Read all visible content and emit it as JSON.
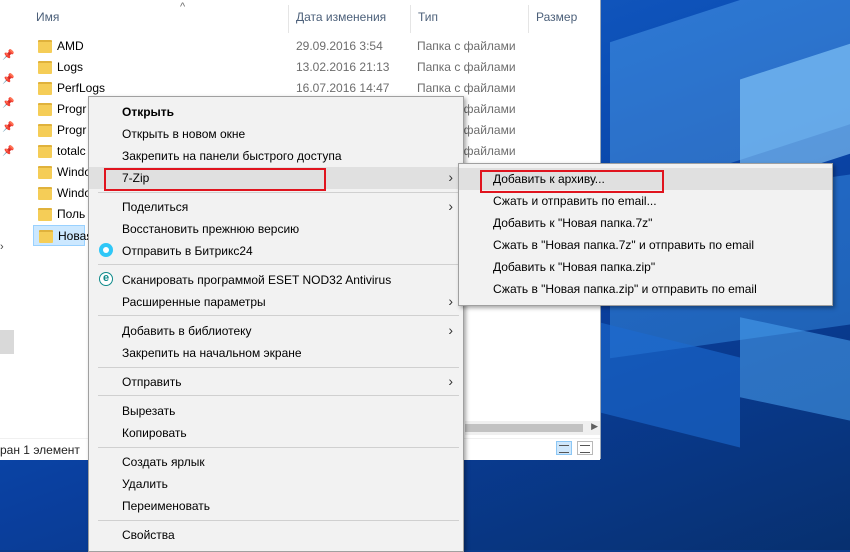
{
  "columns": {
    "name": "Имя",
    "date": "Дата изменения",
    "type": "Тип",
    "size": "Размер"
  },
  "files": [
    {
      "name": "AMD",
      "date": "29.09.2016 3:54",
      "type": "Папка с файлами"
    },
    {
      "name": "Logs",
      "date": "13.02.2016 21:13",
      "type": "Папка с файлами"
    },
    {
      "name": "PerfLogs",
      "date": "16.07.2016 14:47",
      "type": "Папка с файлами"
    },
    {
      "name": "Progr",
      "date": "",
      "type": "Папка с файлами"
    },
    {
      "name": "Progr",
      "date": "",
      "type": "Папка с файлами"
    },
    {
      "name": "totalc",
      "date": "",
      "type": "Папка с файлами"
    },
    {
      "name": "Windo",
      "date": "",
      "type": "Папка с файлами"
    },
    {
      "name": "Windo",
      "date": "",
      "type": "Папка с файлами"
    },
    {
      "name": "Поль",
      "date": "",
      "type": ""
    },
    {
      "name": "Новая",
      "date": "",
      "type": ""
    }
  ],
  "statusbar": {
    "text": "ран 1 элемент"
  },
  "context_menu": {
    "items": {
      "open": "Открыть",
      "open_new_window": "Открыть в новом окне",
      "pin_quick_access": "Закрепить на панели быстрого доступа",
      "seven_zip": "7-Zip",
      "share": "Поделиться",
      "restore_previous": "Восстановить прежнюю версию",
      "send_bitrix": "Отправить в Битрикс24",
      "scan_eset": "Сканировать программой ESET NOD32 Antivirus",
      "advanced": "Расширенные параметры",
      "add_library": "Добавить в библиотеку",
      "pin_start": "Закрепить на начальном экране",
      "send_to": "Отправить",
      "cut": "Вырезать",
      "copy": "Копировать",
      "create_shortcut": "Создать ярлык",
      "delete": "Удалить",
      "rename": "Переименовать",
      "properties": "Свойства"
    }
  },
  "submenu_7zip": {
    "items": [
      "Добавить к архиву...",
      "Сжать и отправить по email...",
      "Добавить к \"Новая папка.7z\"",
      "Сжать в \"Новая папка.7z\" и отправить по email",
      "Добавить к \"Новая папка.zip\"",
      "Сжать в \"Новая папка.zip\" и отправить по email"
    ]
  },
  "icons": {
    "folder": "folder-icon",
    "bitrix": "bitrix24-icon",
    "eset": "eset-icon",
    "submenu_arrow": "chevron-right-icon",
    "pin": "pin-icon"
  },
  "colors": {
    "highlight_box": "#e0141e",
    "folder": "#f5cd57",
    "menu_bg": "#f2f2f2"
  }
}
